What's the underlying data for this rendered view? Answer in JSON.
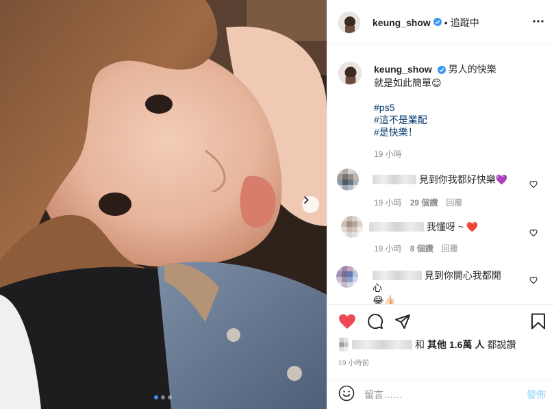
{
  "post": {
    "username": "keung_show",
    "follow_status": "追蹤中",
    "separator": "•",
    "caption_title": "男人的快樂",
    "caption_line2": "就是如此簡單😊",
    "hashtags": [
      "#ps5",
      "#這不是業配",
      "#是快樂！"
    ],
    "caption_time": "19 小時"
  },
  "comments": [
    {
      "text": "見到你我都好快樂💜",
      "time": "19 小時",
      "likes": "29 個讚",
      "reply": "回覆"
    },
    {
      "text": "我懂呀 ~ ❤️",
      "time": "19 小時",
      "likes": "8 個讚",
      "reply": "回覆"
    },
    {
      "text": "見到你開心我都開心",
      "text2": "😂👍🏻"
    }
  ],
  "likes_line": {
    "prefix": "和",
    "others_label": "其他",
    "count": "1.6萬",
    "suffix": "人",
    "action": "都說讚"
  },
  "posted_time": "19 小時前",
  "add_comment": {
    "placeholder": "留言……",
    "post_label": "發佈"
  },
  "carousel": {
    "total": 3,
    "active": 1
  },
  "colors": {
    "like_red": "#ed4956",
    "verified_blue": "#3897f0",
    "hashtag": "#00376b",
    "post_disabled": "#b2dffc"
  },
  "icons": [
    "heart-icon",
    "comment-icon",
    "share-icon",
    "bookmark-icon",
    "more-icon",
    "emoji-icon",
    "verified-icon",
    "chevron-right-icon"
  ]
}
